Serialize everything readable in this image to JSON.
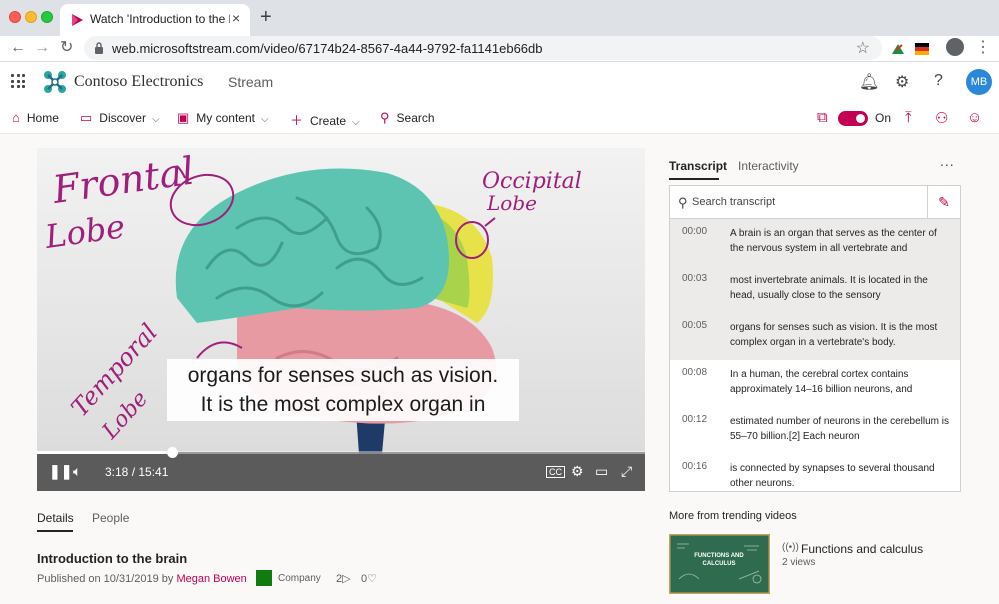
{
  "browser": {
    "tab_title": "Watch 'Introduction to the brain",
    "tab_close": "×",
    "new_tab": "+",
    "url": "web.microsoftstream.com/video/67174b24-8567-4a44-9792-fa1141eb66db"
  },
  "header": {
    "brand": "Contoso Electronics",
    "app": "Stream",
    "avatar_initials": "MB",
    "help": "?"
  },
  "commandbar": {
    "home": "Home",
    "discover": "Discover",
    "my_content": "My content",
    "create": "Create",
    "search": "Search",
    "toggle_label": "On"
  },
  "player": {
    "caption_lines": [
      "organs for senses such as vision.",
      "It is the most complex organ in"
    ],
    "time": "3:18 / 15:41",
    "progress": 0.222,
    "annotations": {
      "frontal": [
        "Frontal",
        "Lobe"
      ],
      "occipital": [
        "Occipital",
        "Lobe"
      ],
      "temporal": [
        "Temporal",
        "Lobe"
      ]
    }
  },
  "details": {
    "tabs": [
      "Details",
      "People"
    ],
    "title": "Introduction to the brain",
    "published_prefix": "Published on 10/31/2019 by",
    "author": "Megan Bowen",
    "company": "Company",
    "views": "2",
    "likes": "0"
  },
  "transcript": {
    "tabs": [
      "Transcript",
      "Interactivity"
    ],
    "more": "...",
    "search_placeholder": "Search transcript",
    "lines": [
      {
        "time": "00:00",
        "text": "A brain is an organ that serves as the center of the nervous system in all vertebrate and",
        "highlight": true
      },
      {
        "time": "00:03",
        "text": "most invertebrate animals. It is located in the head, usually close to the sensory",
        "highlight": true
      },
      {
        "time": "00:05",
        "text": "organs for senses such as vision. It is the most complex organ in a vertebrate's body.",
        "highlight": true
      },
      {
        "time": "00:08",
        "text": "In a human, the cerebral cortex contains approximately 14–16 billion neurons, and",
        "highlight": false
      },
      {
        "time": "00:12",
        "text": "estimated number of neurons in the cerebellum is 55–70 billion.[2] Each neuron",
        "highlight": false
      },
      {
        "time": "00:16",
        "text": "is connected by synapses to several thousand other neurons.",
        "highlight": false
      }
    ]
  },
  "trending": {
    "heading": "More from trending videos",
    "items": [
      {
        "title": "Functions and calculus",
        "views": "2 views",
        "thumb_text": "FUNCTIONS AND CALCULUS"
      }
    ]
  },
  "colors": {
    "accent": "#c30052",
    "avatar": "#2b88d8",
    "brain_teal": "#5ec4b2",
    "brain_pink": "#e89aa3",
    "brain_yellow": "#e8e24a",
    "annotation": "#a01f7a"
  }
}
